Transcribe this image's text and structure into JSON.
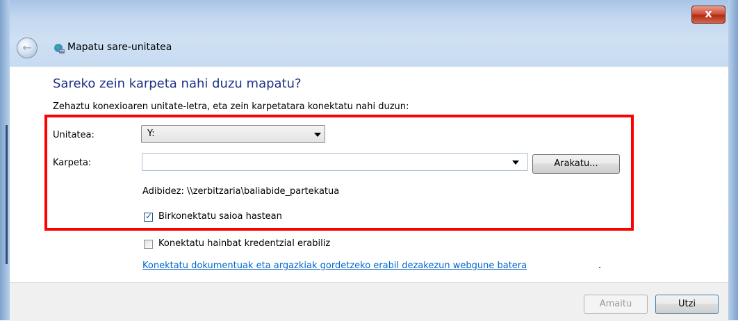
{
  "window": {
    "title": "Mapatu sare-unitatea",
    "close_label": "x"
  },
  "main": {
    "heading": "Sareko zein karpeta nahi duzu mapatu?",
    "subtitle": "Zehaztu konexioaren unitate-letra, eta zein karpetatara konektatu nahi duzun:"
  },
  "form": {
    "drive_label": "Unitatea:",
    "drive_value": "Y:",
    "folder_label": "Karpeta:",
    "folder_value": "",
    "browse_label": "Arakatu...",
    "example_text": "Adibidez: \\\\zerbitzaria\\baliabide_partekatua",
    "reconnect_label": "Birkonektatu saioa hastean",
    "reconnect_checked": true,
    "credentials_label": "Konektatu hainbat kredentzial erabiliz",
    "credentials_checked": false,
    "link_text": "Konektatu dokumentuak eta argazkiak gordetzeko erabil dezakezun webgune batera",
    "link_suffix": "."
  },
  "footer": {
    "finish_label": "Amaitu",
    "cancel_label": "Utzi"
  },
  "colors": {
    "heading": "#1e3287",
    "link": "#0066cc",
    "highlight": "#ff0000"
  }
}
